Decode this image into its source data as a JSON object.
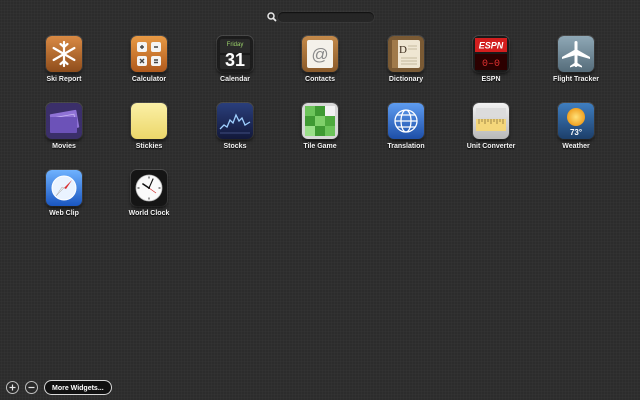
{
  "search": {
    "icon": "magnifier-icon",
    "placeholder": ""
  },
  "widgets": [
    {
      "label": "Ski Report",
      "icon": "snowflake-icon",
      "color": "#b86a2c"
    },
    {
      "label": "Calculator",
      "icon": "calculator-icon",
      "color": "#d07a2a"
    },
    {
      "label": "Calendar",
      "icon": "calendar-icon",
      "color": "#222222",
      "day": "Friday",
      "date": "31"
    },
    {
      "label": "Contacts",
      "icon": "at-sign-icon",
      "color": "#9b6a36"
    },
    {
      "label": "Dictionary",
      "icon": "dictionary-icon",
      "color": "#8a6a40"
    },
    {
      "label": "ESPN",
      "icon": "espn-icon",
      "color": "#c81e1e",
      "brand": "ESPN",
      "score": "0–0"
    },
    {
      "label": "Flight Tracker",
      "icon": "airplane-icon",
      "color": "#6f8a9a"
    },
    {
      "label": "Movies",
      "icon": "ticket-icon",
      "color": "#4d3e86"
    },
    {
      "label": "Stickies",
      "icon": "sticky-note-icon",
      "color": "#f3e48a"
    },
    {
      "label": "Stocks",
      "icon": "stocks-icon",
      "color": "#1b2a5c"
    },
    {
      "label": "Tile Game",
      "icon": "tile-game-icon",
      "color": "#4fa63d"
    },
    {
      "label": "Translation",
      "icon": "globe-icon",
      "color": "#2f6fd0"
    },
    {
      "label": "Unit Converter",
      "icon": "ruler-icon",
      "color": "#d8d8d8"
    },
    {
      "label": "Weather",
      "icon": "weather-sun-icon",
      "color": "#2e6196",
      "temp": "73°"
    },
    {
      "label": "Web Clip",
      "icon": "compass-icon",
      "color": "#2e6fd6"
    },
    {
      "label": "World Clock",
      "icon": "clock-icon",
      "color": "#1a1a1a"
    }
  ],
  "controls": {
    "add_icon": "plus-icon",
    "remove_icon": "minus-icon",
    "more_label": "More Widgets..."
  }
}
